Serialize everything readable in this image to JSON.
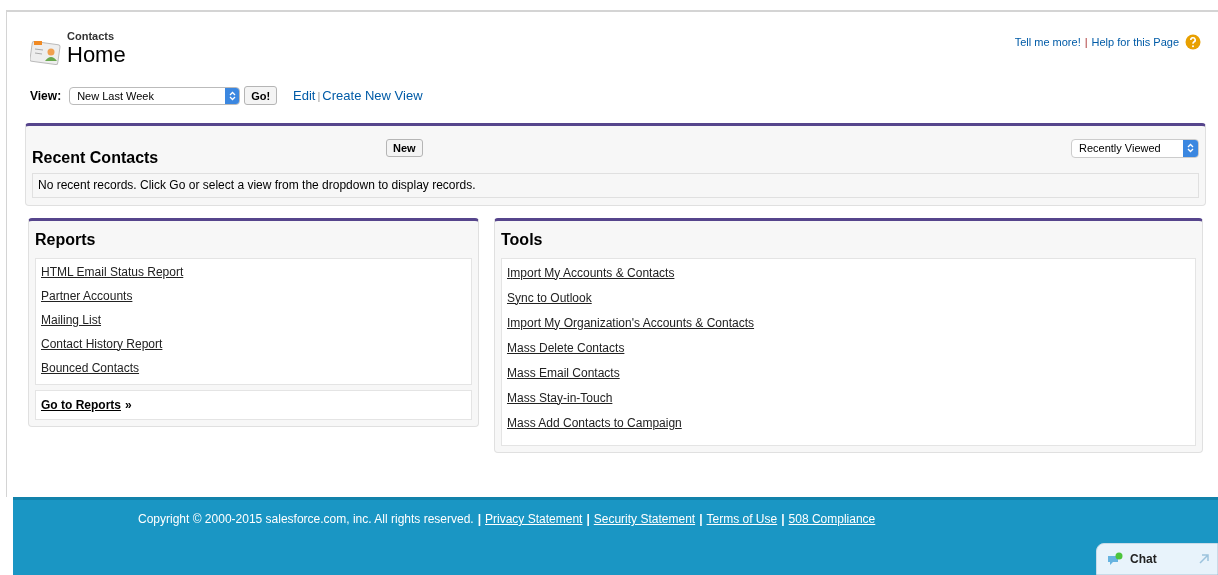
{
  "header": {
    "object": "Contacts",
    "title": "Home",
    "links": [
      "Tell me more!",
      "Help for this Page"
    ],
    "separator": "|"
  },
  "view": {
    "label": "View:",
    "value": "New Last Week",
    "go": "Go!",
    "links": [
      "Edit",
      "Create New View"
    ],
    "separator": "|"
  },
  "recent": {
    "title": "Recent Contacts",
    "button": "New",
    "dropdown": "Recently Viewed",
    "message": "No recent records. Click Go or select a view from the dropdown to display records."
  },
  "reports": {
    "title": "Reports",
    "links": [
      "HTML Email Status Report",
      "Partner Accounts",
      "Mailing List",
      "Contact History Report",
      "Bounced Contacts"
    ],
    "more_link": "Go to Reports",
    "more_suffix": "»"
  },
  "tools": {
    "title": "Tools",
    "links": [
      "Import My Accounts & Contacts",
      "Sync to Outlook",
      "Import My Organization's Accounts & Contacts",
      "Mass Delete Contacts",
      "Mass Email Contacts",
      "Mass Stay-in-Touch",
      "Mass Add Contacts to Campaign"
    ]
  },
  "footer": {
    "copyright": "Copyright © 2000-2015 salesforce.com, inc. All rights reserved.",
    "links": [
      "Privacy Statement",
      "Security Statement",
      "Terms of Use",
      "508 Compliance"
    ],
    "separator": "|"
  },
  "chat": {
    "label": "Chat"
  }
}
